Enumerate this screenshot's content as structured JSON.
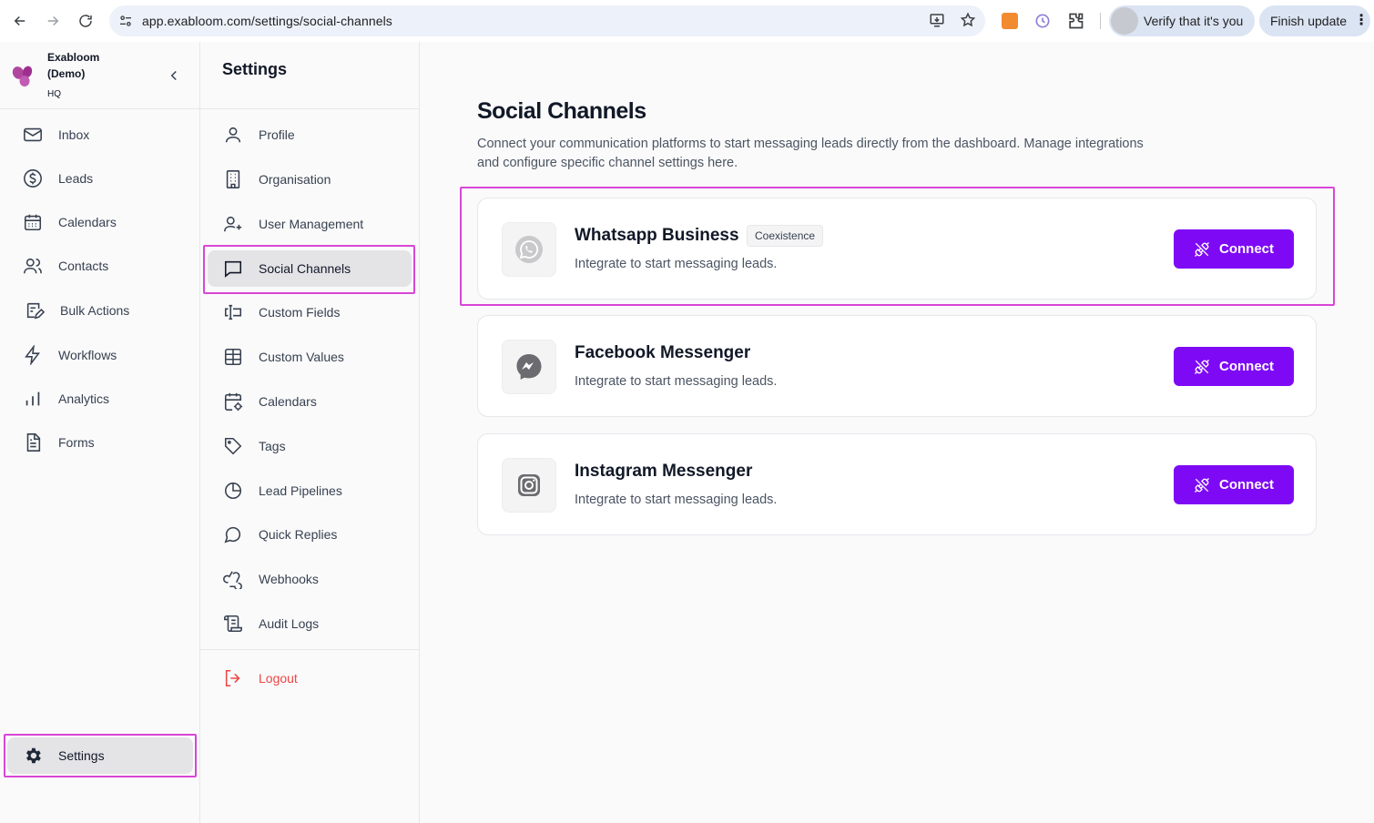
{
  "browser": {
    "url": "app.exabloom.com/settings/social-channels",
    "verify_label": "Verify that it's you",
    "finish_label": "Finish update",
    "menu_glyph": "⋮"
  },
  "brand": {
    "name_line1": "Exabloom",
    "name_line2": "(Demo)",
    "location": "HQ",
    "accent": "#9d2f8f"
  },
  "sidebar": {
    "items": [
      {
        "label": "Inbox",
        "icon": "mail-icon"
      },
      {
        "label": "Leads",
        "icon": "dollar-circle-icon"
      },
      {
        "label": "Calendars",
        "icon": "calendar-icon"
      },
      {
        "label": "Contacts",
        "icon": "users-icon"
      },
      {
        "label": "Bulk Actions",
        "icon": "bulk-actions-icon"
      },
      {
        "label": "Workflows",
        "icon": "lightning-icon"
      },
      {
        "label": "Analytics",
        "icon": "bar-chart-icon"
      },
      {
        "label": "Forms",
        "icon": "document-icon"
      }
    ],
    "settings_label": "Settings"
  },
  "settings_nav": {
    "title": "Settings",
    "items": [
      {
        "label": "Profile",
        "icon": "user-icon"
      },
      {
        "label": "Organisation",
        "icon": "building-icon"
      },
      {
        "label": "User Management",
        "icon": "user-plus-icon"
      },
      {
        "label": "Social Channels",
        "icon": "message-square-icon",
        "active": true
      },
      {
        "label": "Custom Fields",
        "icon": "text-cursor-input-icon"
      },
      {
        "label": "Custom Values",
        "icon": "table-icon"
      },
      {
        "label": "Calendars",
        "icon": "calendar-cog-icon"
      },
      {
        "label": "Tags",
        "icon": "tag-icon"
      },
      {
        "label": "Lead Pipelines",
        "icon": "pie-chart-icon"
      },
      {
        "label": "Quick Replies",
        "icon": "message-circle-icon"
      },
      {
        "label": "Webhooks",
        "icon": "webhook-icon"
      },
      {
        "label": "Audit Logs",
        "icon": "scroll-icon"
      }
    ],
    "logout_label": "Logout"
  },
  "main": {
    "title": "Social Channels",
    "description": "Connect your communication platforms to start messaging leads directly from the dashboard. Manage integrations and configure specific channel settings here.",
    "channels": [
      {
        "name": "Whatsapp Business",
        "badge": "Coexistence",
        "subtitle": "Integrate to start messaging leads.",
        "button": "Connect",
        "icon": "whatsapp-icon"
      },
      {
        "name": "Facebook Messenger",
        "subtitle": "Integrate to start messaging leads.",
        "button": "Connect",
        "icon": "messenger-icon"
      },
      {
        "name": "Instagram Messenger",
        "subtitle": "Integrate to start messaging leads.",
        "button": "Connect",
        "icon": "instagram-icon"
      }
    ],
    "button_color": "#7e0af5",
    "highlight_color": "#d946d6"
  }
}
